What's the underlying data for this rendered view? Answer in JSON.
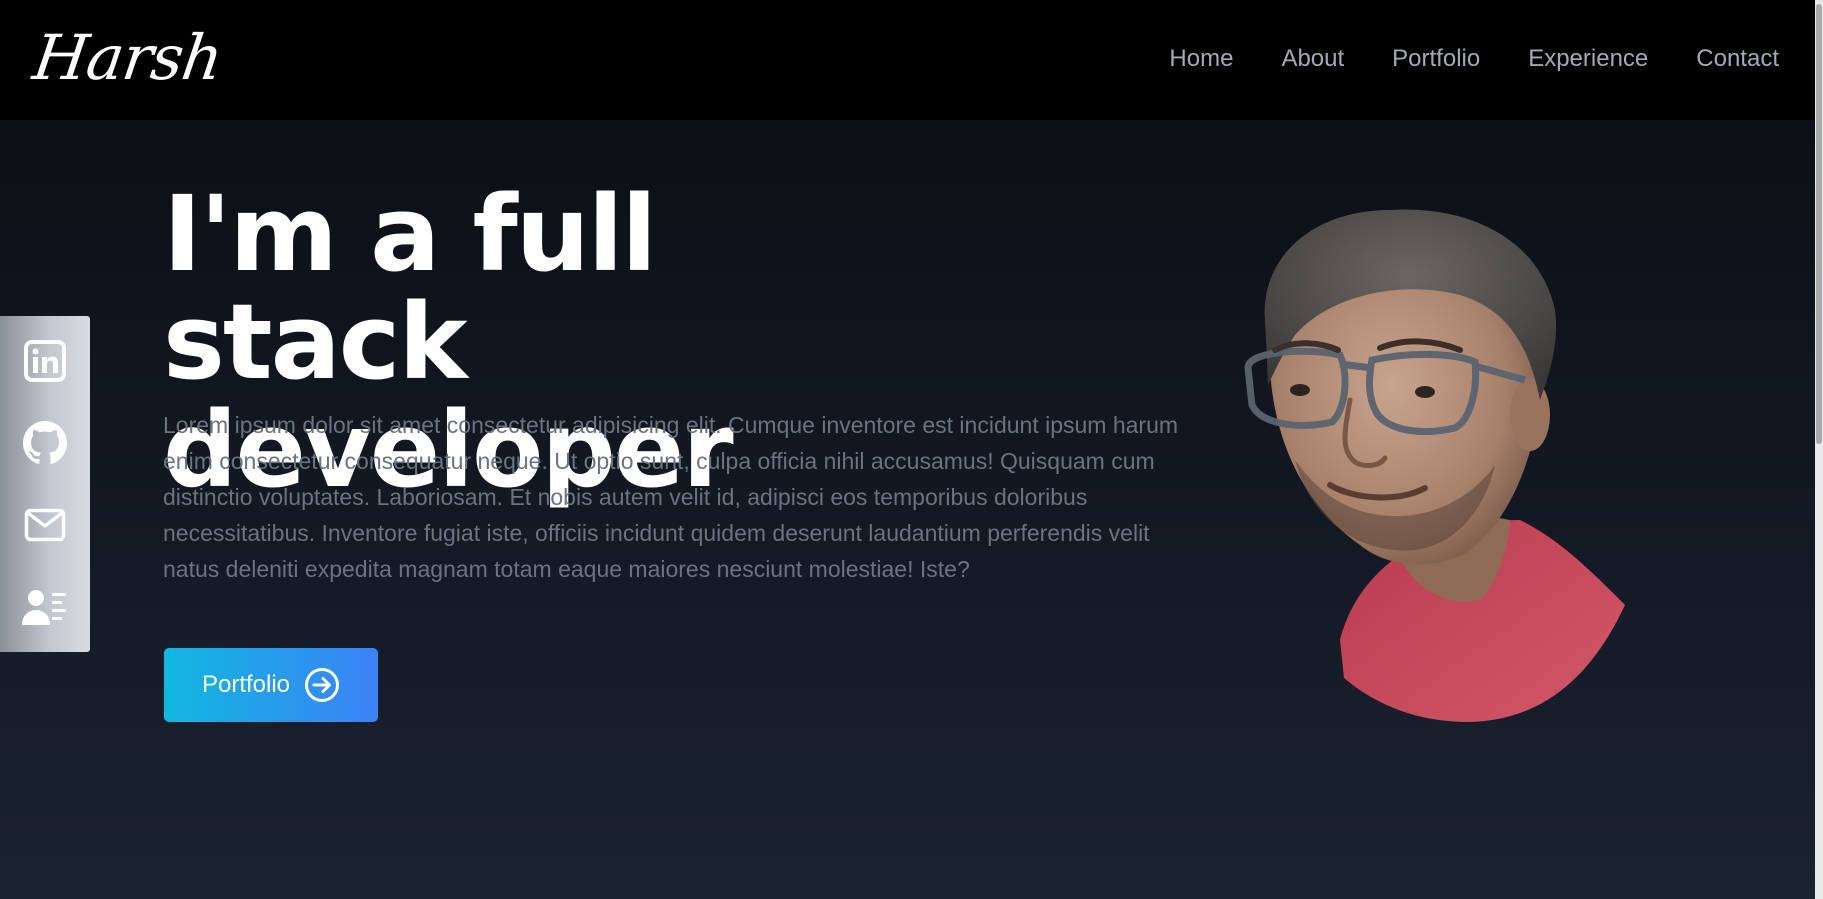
{
  "header": {
    "logo_text": "Harsh",
    "nav": [
      {
        "label": "Home"
      },
      {
        "label": "About"
      },
      {
        "label": "Portfolio"
      },
      {
        "label": "Experience"
      },
      {
        "label": "Contact"
      }
    ]
  },
  "social": [
    {
      "icon": "linkedin-icon"
    },
    {
      "icon": "github-icon"
    },
    {
      "icon": "mail-icon"
    },
    {
      "icon": "contact-card-icon"
    }
  ],
  "hero": {
    "title_line1": "I'm a full stack",
    "title_line2": "developer",
    "description": "Lorem ipsum dolor sit amet consectetur adipisicing elit. Cumque inventore est incidunt ipsum harum enim consectetur consequatur neque. Ut optio sunt, culpa officia nihil accusamus! Quisquam cum distinctio voluptates. Laboriosam. Et nobis autem velit id, adipisci eos temporibus doloribus necessitatibus. Inventore fugiat iste, officiis incidunt quidem deserunt laudantium perferendis velit natus deleniti expedita magnam totam eaque maiores nesciunt molestiae! Iste?",
    "button_label": "Portfolio",
    "button_icon": "arrow-right-circle-icon"
  },
  "colors": {
    "header_bg": "#000000",
    "nav_text": "#a3a9b5",
    "title_text": "#ffffff",
    "body_text": "#6b7280",
    "button_gradient_start": "#12b7e0",
    "button_gradient_end": "#3b82f6"
  }
}
